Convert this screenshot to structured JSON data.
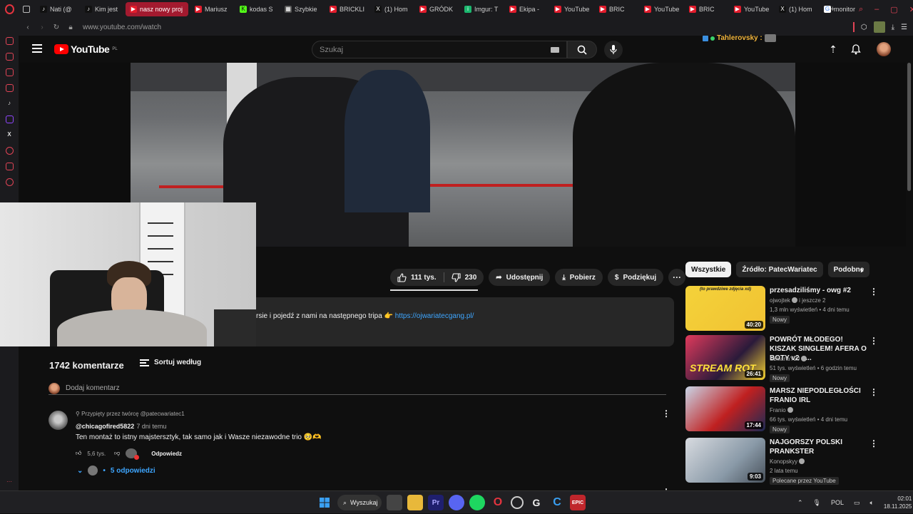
{
  "browser": {
    "tabs": [
      {
        "label": "Nati (@",
        "icon": "tiktok-icon",
        "active": false
      },
      {
        "label": "Kim jest",
        "icon": "tiktok-icon",
        "active": false
      },
      {
        "label": "nasz nowy proj",
        "icon": "youtube-icon",
        "active": true
      },
      {
        "label": "Mariusz",
        "icon": "youtube-icon",
        "active": false
      },
      {
        "label": "kodas S",
        "icon": "kick-icon",
        "active": false
      },
      {
        "label": "Szybkie",
        "icon": "grid-icon",
        "active": false
      },
      {
        "label": "BRICKLI",
        "icon": "youtube-icon",
        "active": false
      },
      {
        "label": "(1) Hom",
        "icon": "x-icon",
        "active": false
      },
      {
        "label": "GRÓDK",
        "icon": "youtube-icon",
        "active": false
      },
      {
        "label": "Imgur: T",
        "icon": "imgur-icon",
        "active": false
      },
      {
        "label": "Ekipa -",
        "icon": "youtube-icon",
        "active": false
      },
      {
        "label": "YouTube",
        "icon": "youtube-icon",
        "active": false
      },
      {
        "label": "BRIC",
        "icon": "youtube-icon",
        "active": false
      },
      {
        "label": "YouTube",
        "icon": "youtube-icon",
        "active": false
      },
      {
        "label": "BRIC",
        "icon": "youtube-icon",
        "active": false
      },
      {
        "label": "YouTube",
        "icon": "youtube-icon",
        "active": false
      },
      {
        "label": "(1) Hom",
        "icon": "x-icon",
        "active": false
      },
      {
        "label": "monitor",
        "icon": "google-icon",
        "active": false
      }
    ],
    "url": "www.youtube.com/watch"
  },
  "header": {
    "logo_text": "YouTube",
    "region": "PL",
    "search_placeholder": "Szukaj",
    "twitch_user": "Tahlerovsky :"
  },
  "actions": {
    "likes": "111 tys.",
    "dislikes": "230",
    "share": "Udostępnij",
    "download": "Pobierz",
    "thanks": "Podziękuj"
  },
  "description": {
    "text": "rsie i pojedź z nami na następnego tripa 👉 ",
    "link": "https://ojwariatecgang.pl/"
  },
  "comments": {
    "count": "1742 komentarze",
    "sort": "Sortuj według",
    "add_placeholder": "Dodaj komentarz",
    "pinned": "Przypięty przez twórcę @patecwariatec1",
    "author": "@chicagofired5822",
    "time": "7 dni temu",
    "text": "Ten montaż to istny majstersztyk, tak samo jak i Wasze niezawodne trio 🥺🫶",
    "likes": "5,6 tys.",
    "reply": "Odpowiedz",
    "replies": "5 odpowiedzi"
  },
  "chips": [
    "Wszystkie",
    "Źródło: PatecWariatec",
    "Podobne"
  ],
  "recommendations": [
    {
      "title": "przesadziliśmy - owg #2",
      "channel": "ojwojtek",
      "channel_extra": "i jeszcze 2",
      "meta": "1,3 mln wyświetleń • 4 dni temu",
      "badge": "Nowy",
      "duration": "40:20",
      "thumb_caption": "(to prawdziwe zdjęcia xd)"
    },
    {
      "title": "POWRÓT MŁODEGO! KISZAK SINGLEM! AFERA O BOTY v2 - ...",
      "channel": "SzklanaY2J",
      "channel_extra": "",
      "meta": "51 tys. wyświetleń • 6 godzin temu",
      "badge": "Nowy",
      "duration": "26:41",
      "thumb_caption": "STREAM ROT"
    },
    {
      "title": "MARSZ NIEPODLEGŁOŚCI FRANIO IRL",
      "channel": "Franio",
      "channel_extra": "",
      "meta": "66 tys. wyświetleń • 4 dni temu",
      "badge": "Nowy",
      "duration": "17:44",
      "thumb_caption": ""
    },
    {
      "title": "NAJGORSZY POLSKI PRANKSTER",
      "channel": "Konopskyy",
      "channel_extra": "",
      "meta": "2 lata temu",
      "badge": "Polecane przez YouTube",
      "duration": "9:03",
      "thumb_caption": ""
    }
  ],
  "taskbar": {
    "search": "Wyszukaj",
    "lang": "POL",
    "time": "02:01",
    "date": "18.11.2025"
  }
}
